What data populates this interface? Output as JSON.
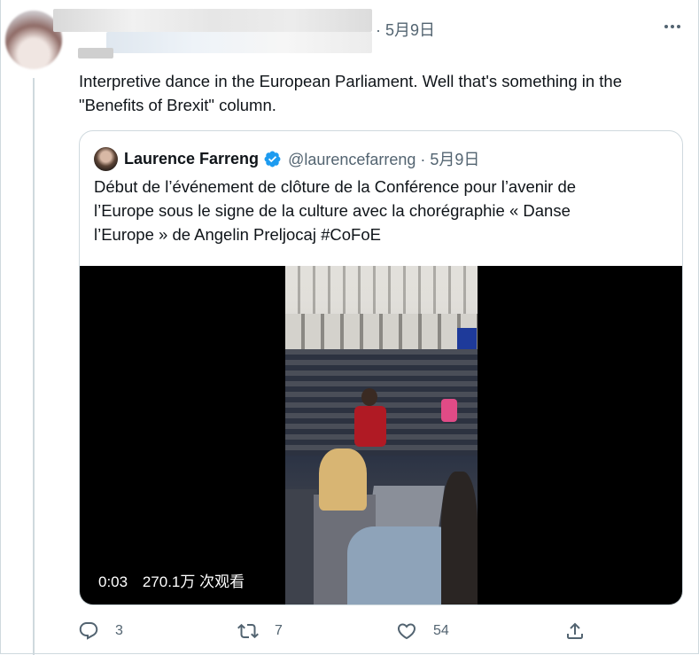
{
  "header": {
    "date": "· 5月9日"
  },
  "tweet": {
    "text_line1": "Interpretive dance in the European Parliament. Well that's something in the",
    "text_line2": "\"Benefits of Brexit\" column."
  },
  "quoted_tweet": {
    "name": "Laurence Farreng",
    "handle_date": "@laurencefarreng · 5月9日",
    "text_line1": "Début de l’événement de clôture de la Conférence pour l’avenir de",
    "text_line2": "l’Europe sous le signe de la culture avec la chorégraphie « Danse",
    "text_line3": "l’Europe » de Angelin Preljocaj #CoFoE",
    "video": {
      "time": "0:03",
      "views": "270.1万 次观看"
    }
  },
  "actions": {
    "replies": "3",
    "retweets": "7",
    "likes": "54"
  },
  "colors": {
    "text": "#0f1419",
    "secondary": "#536471",
    "border": "#cfd9de",
    "verified": "#1d9bf0"
  },
  "icons": [
    "more-icon",
    "verified-icon",
    "reply-icon",
    "retweet-icon",
    "like-icon",
    "share-icon"
  ]
}
